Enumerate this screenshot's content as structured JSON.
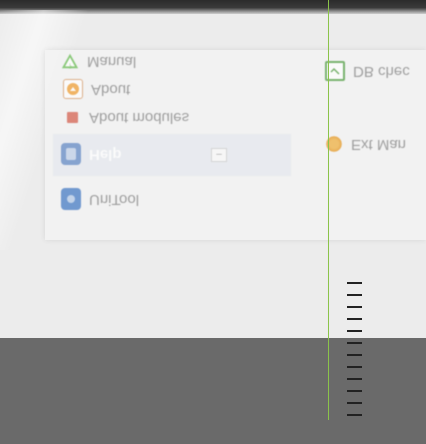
{
  "menu": {
    "items": [
      {
        "id": "manual",
        "label": "Manual",
        "icon": "triangle-warning-icon"
      },
      {
        "id": "about",
        "label": "About",
        "icon": "about-icon"
      },
      {
        "id": "about_modules",
        "label": "About modules",
        "icon": "modules-icon"
      },
      {
        "id": "help",
        "label": "Help",
        "icon": "help-icon"
      },
      {
        "id": "unitool",
        "label": "UniTool",
        "icon": "unitool-icon"
      },
      {
        "id": "db_check",
        "label": "DB chec",
        "icon": "db-check-icon"
      },
      {
        "id": "ext_man",
        "label": "Ext Man",
        "icon": "ext-man-icon"
      }
    ],
    "collapse_symbol": "–"
  },
  "colors": {
    "guide_line": "#8bc34a",
    "bottom_band": "#6a6a6a"
  }
}
